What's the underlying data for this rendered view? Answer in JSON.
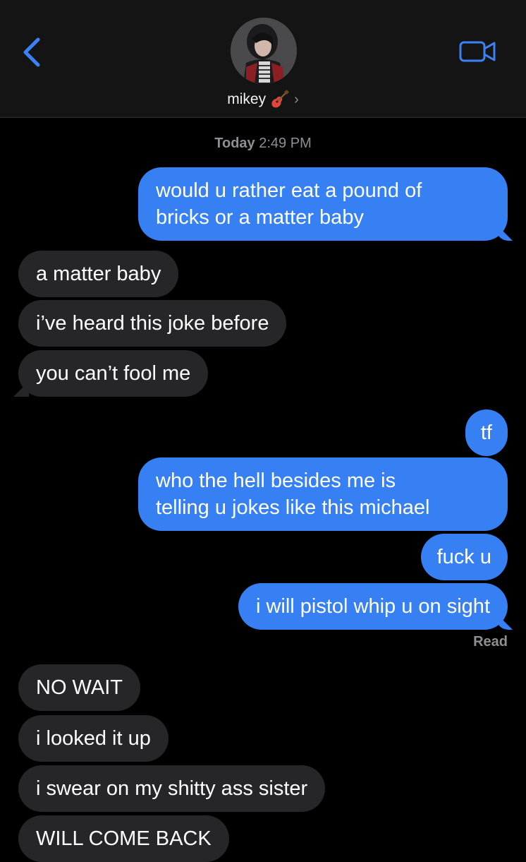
{
  "header": {
    "contact_name": "mikey",
    "contact_emoji": "guitar-icon",
    "chevron": "›",
    "back_icon": "chevron-left-icon",
    "video_icon": "video-camera-icon"
  },
  "thread": {
    "timestamp_day": "Today",
    "timestamp_time": "2:49 PM",
    "read_receipt": "Read",
    "messages": [
      {
        "from": "me",
        "text_lines": [
          "would u rather eat a pound of",
          "bricks or a matter baby"
        ]
      },
      {
        "from": "them",
        "text": "a matter baby"
      },
      {
        "from": "them",
        "text": "i’ve heard this joke before"
      },
      {
        "from": "them",
        "text": "you can’t fool me"
      },
      {
        "from": "me",
        "text": "tf"
      },
      {
        "from": "me",
        "text_lines": [
          "who the hell besides me is",
          "telling u jokes like this michael"
        ]
      },
      {
        "from": "me",
        "text": "fuck u"
      },
      {
        "from": "me",
        "text": "i will pistol whip u on sight"
      },
      {
        "from": "them",
        "text": "NO WAIT"
      },
      {
        "from": "them",
        "text": "i looked it up"
      },
      {
        "from": "them",
        "text": "i swear on my shitty ass sister"
      },
      {
        "from": "them",
        "text": "WILL COME BACK"
      }
    ]
  },
  "colors": {
    "outgoing_bubble": "#3780f4",
    "incoming_bubble": "#262628",
    "accent": "#3b82f6",
    "header_bg": "#141414"
  }
}
